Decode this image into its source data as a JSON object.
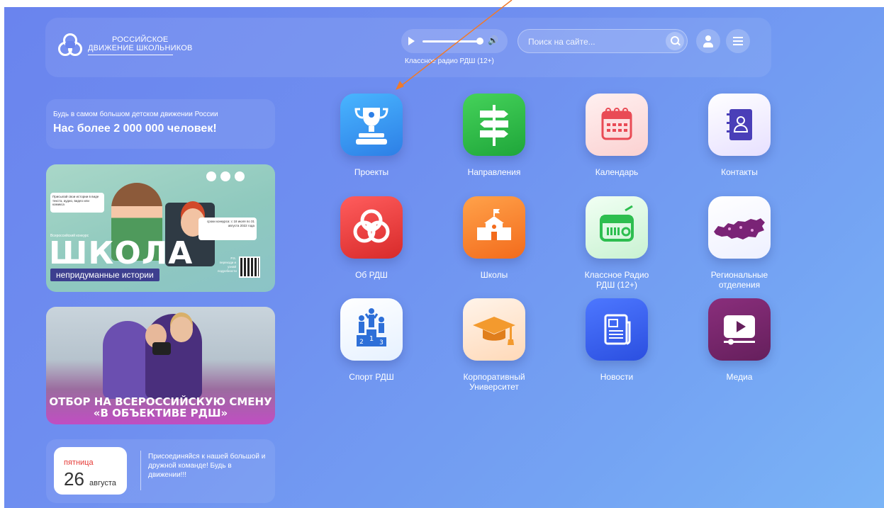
{
  "header": {
    "logo_line1": "РОССИЙСКОЕ",
    "logo_line2": "ДВИЖЕНИЕ ШКОЛЬНИКОВ",
    "radio_label": "Классное радио РДШ (12+)",
    "search_placeholder": "Поиск на сайте...",
    "icons": [
      "play-icon",
      "volume-icon",
      "search-icon",
      "user-icon",
      "menu-icon"
    ]
  },
  "promo": {
    "subtitle": "Будь в самом большом детском движении России",
    "title": "Нас более 2 000 000 человек!"
  },
  "banner1": {
    "note": "Присылай свои истории в виде текста, аудио, видео или комикса",
    "small": "Всероссийский конкурс",
    "title": "ШКОЛА",
    "subtitle": "непридуманные истории",
    "terms": "сроки конкурса: с 18 июля по 31 августа 2022 года",
    "qr_text": "Р.S. переходи и узнай подробности"
  },
  "banner2": {
    "title_line1": "ОТБОР НА ВСЕРОССИЙСКУЮ СМЕНУ",
    "title_line2": "«В ОБЪЕКТИВЕ РДШ»"
  },
  "date_card": {
    "weekday": "пятница",
    "day": "26",
    "month": "августа",
    "message": "Присоединяйся к нашей большой и дружной команде! Будь в движении!!!"
  },
  "tiles": [
    {
      "label": "Проекты",
      "icon": "trophy-icon"
    },
    {
      "label": "Направления",
      "icon": "signpost-icon"
    },
    {
      "label": "Календарь",
      "icon": "calendar-icon"
    },
    {
      "label": "Контакты",
      "icon": "contacts-book-icon"
    },
    {
      "label": "Об РДШ",
      "icon": "rdsh-logo-icon"
    },
    {
      "label": "Школы",
      "icon": "school-icon"
    },
    {
      "label": "Классное Радио РДШ (12+)",
      "icon": "radio-icon"
    },
    {
      "label": "Региональные отделения",
      "icon": "russia-map-icon"
    },
    {
      "label": "Спорт РДШ",
      "icon": "podium-icon"
    },
    {
      "label": "Корпоративный Университет",
      "icon": "graduation-cap-icon"
    },
    {
      "label": "Новости",
      "icon": "newspaper-icon"
    },
    {
      "label": "Медиа",
      "icon": "media-player-icon"
    }
  ],
  "colors": {
    "background_start": "#6a84ee",
    "background_end": "#7ab4f6",
    "annotation_arrow": "#f07a2a",
    "weekday": "#e53935"
  }
}
